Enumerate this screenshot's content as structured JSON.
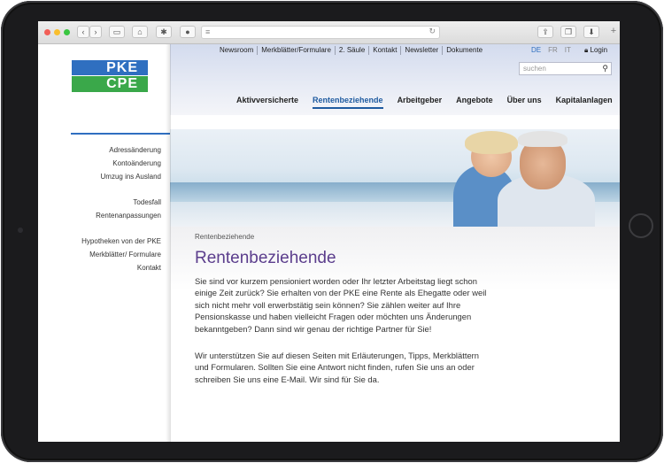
{
  "browser": {
    "url": ""
  },
  "site": {
    "logo_top": "PKE",
    "logo_bottom": "CPE",
    "top_links": [
      "Newsroom",
      "Merkblätter/Formulare",
      "2. Säule",
      "Kontakt",
      "Newsletter",
      "Dokumente"
    ],
    "languages": [
      "DE",
      "FR",
      "IT"
    ],
    "login": "Login",
    "search_placeholder": "suchen",
    "main_nav": [
      "Aktivversicherte",
      "Rentenbeziehende",
      "Arbeitgeber",
      "Angebote",
      "Über uns",
      "Kapitalanlagen"
    ],
    "active_nav": "Rentenbeziehende"
  },
  "sidebar": {
    "group1": [
      "Adressänderung",
      "Kontoänderung",
      "Umzug ins Ausland"
    ],
    "group2": [
      "Todesfall",
      "Rentenanpassungen"
    ],
    "group3": [
      "Hypotheken von der PKE",
      "Merkblätter/ Formulare",
      "Kontakt"
    ]
  },
  "content": {
    "breadcrumb": "Rentenbeziehende",
    "title": "Rentenbeziehende",
    "paragraph1": "Sie sind vor kurzem pensioniert worden oder Ihr letzter Arbeitstag liegt schon einige Zeit zurück? Sie erhalten von der PKE eine Rente als Ehegatte oder weil sich nicht mehr voll erwerbstätig sein können? Sie zählen weiter auf Ihre Pensionskasse und haben vielleicht Fragen oder möchten uns Änderungen bekanntgeben? Dann sind wir genau der richtige Partner für Sie!",
    "paragraph2": "Wir unterstützen Sie auf diesen Seiten mit Erläuterungen, Tipps, Merkblättern und Formularen. Sollten Sie eine Antwort nicht finden, rufen Sie uns an oder schreiben Sie uns eine E-Mail. Wir sind für Sie da."
  },
  "colors": {
    "brand_blue": "#2f6fc0",
    "brand_green": "#3aa84a",
    "title_purple": "#5b3d8c"
  }
}
